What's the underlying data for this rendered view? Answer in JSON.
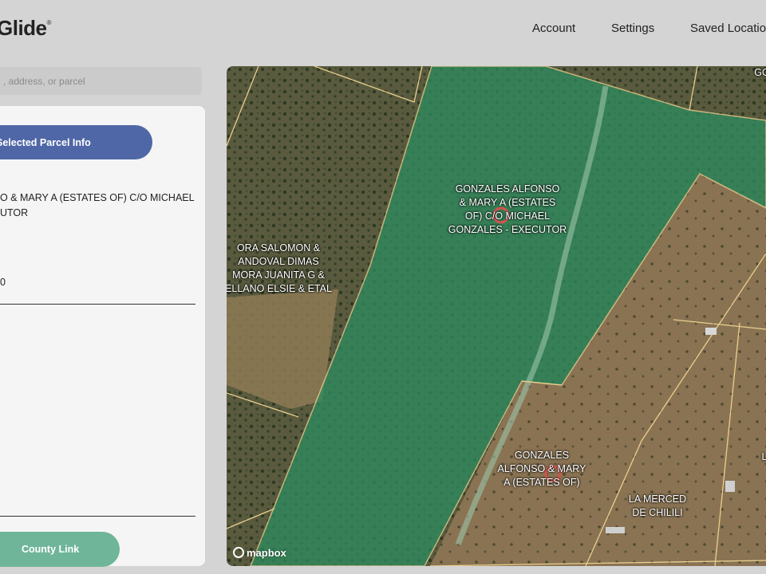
{
  "app": {
    "brand": "Glide",
    "brand_mark": "®"
  },
  "nav": {
    "items": [
      "Account",
      "Settings",
      "Saved Locations"
    ]
  },
  "search": {
    "placeholder": ", address, or parcel"
  },
  "panel": {
    "close_button": "ose Selected Parcel Info",
    "owner": "O & MARY A (ESTATES OF) C/O MICHAEL\nUTOR",
    "field_value": "0",
    "county_button": "County Link"
  },
  "map": {
    "attribution": "mapbox",
    "parcel_labels": [
      "GONZALES ALFONSO\n& MARY A (ESTATES\nOF) C/O MICHAEL\nGONZALES - EXECUTOR",
      "ORA SALOMON &\nANDOVAL DIMAS\nMORA JUANITA G &\nELLANO ELSIE & ETAL",
      "GONZALES\nALFONSO & MARY\nA (ESTATES OF)",
      "LA MERCED\nDE CHILILI",
      "GO",
      "L"
    ],
    "colors": {
      "selected_parcel": "#2e8a5e",
      "parcel_border": "#e8cf8e",
      "marker": "#d9534f"
    }
  }
}
